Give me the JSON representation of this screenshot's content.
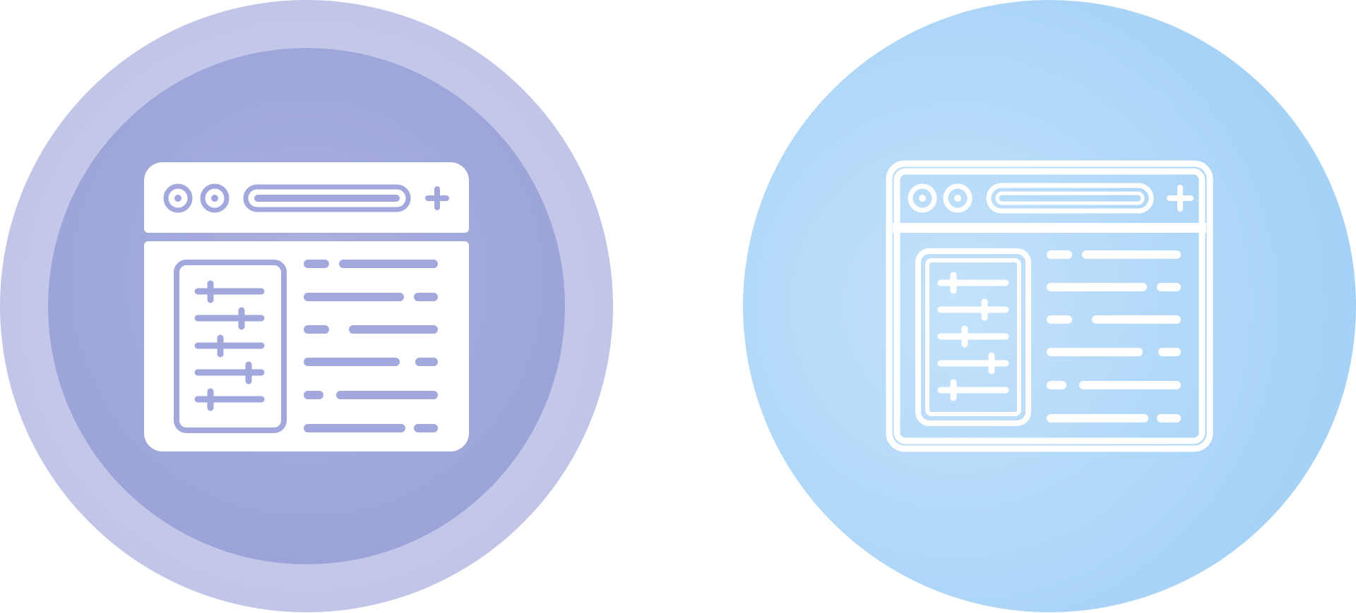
{
  "icons": [
    {
      "name": "browser-settings-icon",
      "variant": "glyph",
      "colors": {
        "outer_ring": "#c5c8e8",
        "inner_fill_light": "#aab0de",
        "inner_fill_dark": "#9aa2d8",
        "foreground": "#ffffff",
        "detail": "#a2a8dc"
      }
    },
    {
      "name": "browser-settings-icon",
      "variant": "line",
      "colors": {
        "fill_center": "#c4e2fb",
        "fill_edge": "#a2d0f6",
        "stroke": "#ffffff"
      }
    }
  ]
}
